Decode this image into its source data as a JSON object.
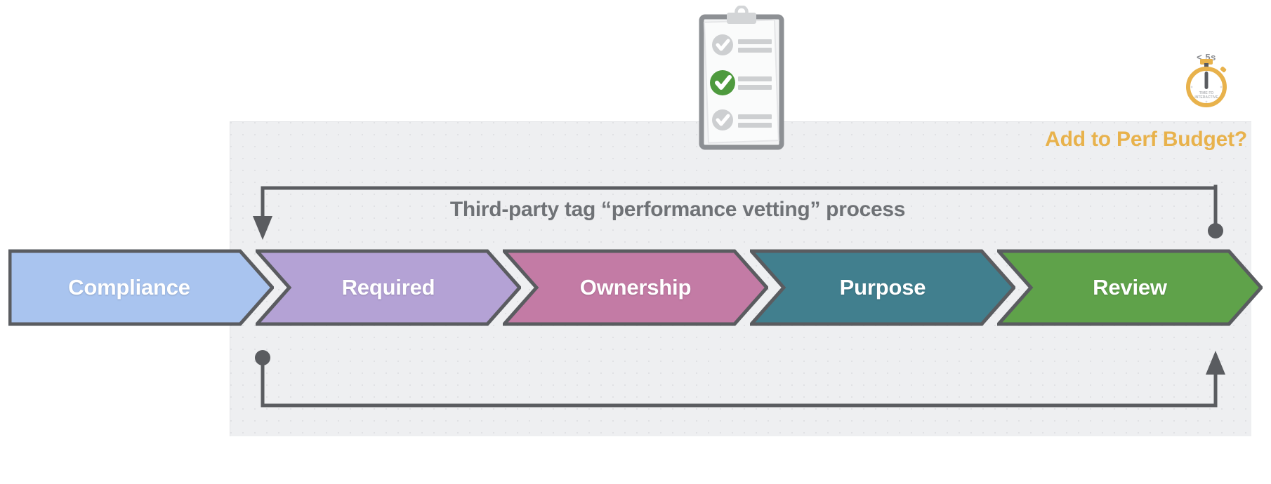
{
  "diagram": {
    "title": "Third-party tag “performance vetting” process",
    "panel_heading": "Add to Perf Budget?",
    "accent_color": "#e8b24c",
    "line_color": "#5a5c60",
    "panel_bg": "#eeeff1"
  },
  "stages": [
    {
      "label": "Compliance",
      "color": "#a9c4ef",
      "name": "stage-compliance"
    },
    {
      "label": "Required",
      "color": "#b4a2d5",
      "name": "stage-required"
    },
    {
      "label": "Ownership",
      "color": "#c37ba5",
      "name": "stage-ownership"
    },
    {
      "label": "Purpose",
      "color": "#417f8e",
      "name": "stage-purpose"
    },
    {
      "label": "Review",
      "color": "#5fa24a",
      "name": "stage-review"
    }
  ],
  "stopwatch": {
    "caption": "< 5s",
    "dial_line_1": "TIME-TO",
    "dial_line_2": "INTERACTIVE",
    "color": "#e8b24c"
  },
  "clipboard": {
    "checked_items": 3,
    "active_item_index": 2,
    "active_color": "#4e9a3e",
    "inactive_color": "#c9cbcd"
  },
  "loops": [
    {
      "name": "loop-review-to-compliance",
      "from": "Review",
      "to": "Compliance",
      "position": "top"
    },
    {
      "name": "loop-compliance-to-review",
      "from": "Compliance",
      "to": "Review",
      "position": "bottom"
    }
  ]
}
